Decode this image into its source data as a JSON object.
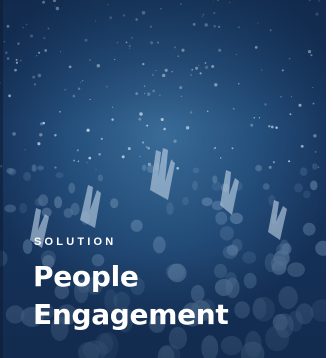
{
  "card": {
    "eyebrow": "SOLUTION",
    "title_line1": "People",
    "title_line2": "Engagement",
    "overlay_color": "#1c3a63",
    "text_color": "#ffffff",
    "image_subject": "concert-crowd-photo"
  }
}
